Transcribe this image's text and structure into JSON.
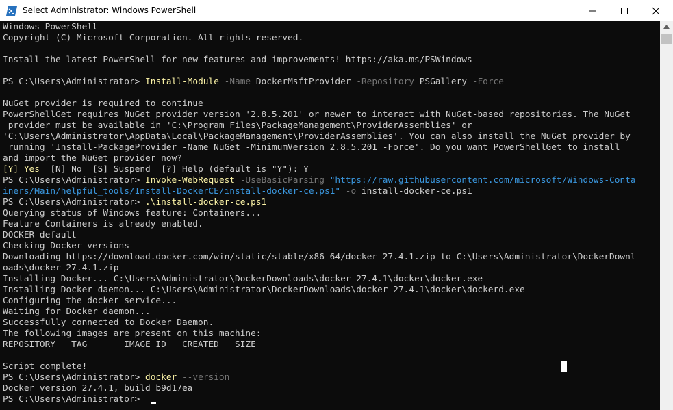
{
  "window": {
    "title": "Select Administrator: Windows PowerShell",
    "icon": "powershell-icon",
    "controls": [
      "minimize-icon",
      "maximize-icon",
      "close-icon"
    ]
  },
  "colors": {
    "background": "#0c0c0c",
    "text": "#cccccc",
    "command": "#f9f1a5",
    "parameter": "#767676",
    "string": "#3a96dd"
  },
  "console": {
    "lines": [
      [
        {
          "t": "text",
          "s": "Windows PowerShell"
        }
      ],
      [
        {
          "t": "text",
          "s": "Copyright (C) Microsoft Corporation. All rights reserved."
        }
      ],
      [],
      [
        {
          "t": "text",
          "s": "Install the latest PowerShell for new features and improvements! https://aka.ms/PSWindows"
        }
      ],
      [],
      [
        {
          "t": "prompt",
          "s": "PS C:\\Users\\Administrator> "
        },
        {
          "t": "cmd",
          "s": "Install-Module"
        },
        {
          "t": "par",
          "s": " -Name"
        },
        {
          "t": "arg",
          "s": " DockerMsftProvider"
        },
        {
          "t": "par",
          "s": " -Repository"
        },
        {
          "t": "arg",
          "s": " PSGallery"
        },
        {
          "t": "par",
          "s": " -Force"
        }
      ],
      [],
      [
        {
          "t": "text",
          "s": "NuGet provider is required to continue"
        }
      ],
      [
        {
          "t": "text",
          "s": "PowerShellGet requires NuGet provider version '2.8.5.201' or newer to interact with NuGet-based repositories. The NuGet"
        }
      ],
      [
        {
          "t": "text",
          "s": " provider must be available in 'C:\\Program Files\\PackageManagement\\ProviderAssemblies' or"
        }
      ],
      [
        {
          "t": "text",
          "s": "'C:\\Users\\Administrator\\AppData\\Local\\PackageManagement\\ProviderAssemblies'. You can also install the NuGet provider by"
        }
      ],
      [
        {
          "t": "text",
          "s": " running 'Install-PackageProvider -Name NuGet -MinimumVersion 2.8.5.201 -Force'. Do you want PowerShellGet to install"
        }
      ],
      [
        {
          "t": "text",
          "s": "and import the NuGet provider now?"
        }
      ],
      [
        {
          "t": "cmd",
          "s": "[Y] Yes"
        },
        {
          "t": "text",
          "s": "  [N] No  [S] Suspend  [?] Help (default is \"Y\"): Y"
        }
      ],
      [
        {
          "t": "prompt",
          "s": "PS C:\\Users\\Administrator> "
        },
        {
          "t": "cmd",
          "s": "Invoke-WebRequest"
        },
        {
          "t": "par",
          "s": " -UseBasicParsing"
        },
        {
          "t": "str",
          "s": " \"https://raw.githubusercontent.com/microsoft/Windows-Conta"
        }
      ],
      [
        {
          "t": "str",
          "s": "iners/Main/helpful_tools/Install-DockerCE/install-docker-ce.ps1\""
        },
        {
          "t": "par",
          "s": " -o"
        },
        {
          "t": "arg",
          "s": " install-docker-ce.ps1"
        }
      ],
      [
        {
          "t": "prompt",
          "s": "PS C:\\Users\\Administrator> "
        },
        {
          "t": "cmd",
          "s": ".\\install-docker-ce.ps1"
        }
      ],
      [
        {
          "t": "text",
          "s": "Querying status of Windows feature: Containers..."
        }
      ],
      [
        {
          "t": "text",
          "s": "Feature Containers is already enabled."
        }
      ],
      [
        {
          "t": "text",
          "s": "DOCKER default"
        }
      ],
      [
        {
          "t": "text",
          "s": "Checking Docker versions"
        }
      ],
      [
        {
          "t": "text",
          "s": "Downloading https://download.docker.com/win/static/stable/x86_64/docker-27.4.1.zip to C:\\Users\\Administrator\\DockerDownl"
        }
      ],
      [
        {
          "t": "text",
          "s": "oads\\docker-27.4.1.zip"
        }
      ],
      [
        {
          "t": "text",
          "s": "Installing Docker... C:\\Users\\Administrator\\DockerDownloads\\docker-27.4.1\\docker\\docker.exe"
        }
      ],
      [
        {
          "t": "text",
          "s": "Installing Docker daemon... C:\\Users\\Administrator\\DockerDownloads\\docker-27.4.1\\docker\\dockerd.exe"
        }
      ],
      [
        {
          "t": "text",
          "s": "Configuring the docker service..."
        }
      ],
      [
        {
          "t": "text",
          "s": "Waiting for Docker daemon..."
        }
      ],
      [
        {
          "t": "text",
          "s": "Successfully connected to Docker Daemon."
        }
      ],
      [
        {
          "t": "text",
          "s": "The following images are present on this machine:"
        }
      ],
      [
        {
          "t": "text",
          "s": "REPOSITORY   TAG       IMAGE ID   CREATED   SIZE"
        }
      ],
      [],
      [
        {
          "t": "text",
          "s": "Script complete!"
        }
      ],
      [
        {
          "t": "prompt",
          "s": "PS C:\\Users\\Administrator> "
        },
        {
          "t": "cmd",
          "s": "docker"
        },
        {
          "t": "par",
          "s": " --version"
        }
      ],
      [
        {
          "t": "text",
          "s": "Docker version 27.4.1, build b9d17ea"
        }
      ],
      [
        {
          "t": "prompt",
          "s": "PS C:\\Users\\Administrator> "
        }
      ]
    ]
  }
}
